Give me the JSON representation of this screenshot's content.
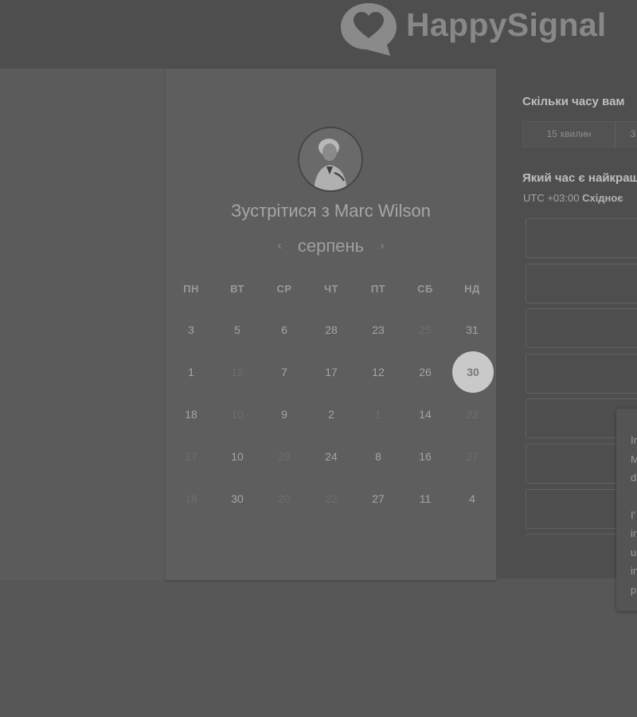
{
  "brand": {
    "name": "HappySignal"
  },
  "calendar": {
    "title": "Зустрітися з Marc Wilson",
    "month": "серпень",
    "prev_arrow": "‹",
    "next_arrow": "›",
    "weekdays": [
      "ПН",
      "ВТ",
      "СР",
      "ЧТ",
      "ПТ",
      "СБ",
      "НД"
    ],
    "weeks": [
      [
        {
          "d": "3",
          "off": false
        },
        {
          "d": "5",
          "off": false
        },
        {
          "d": "6",
          "off": false
        },
        {
          "d": "28",
          "off": false
        },
        {
          "d": "23",
          "off": false
        },
        {
          "d": "25",
          "off": true
        },
        {
          "d": "31",
          "off": false
        }
      ],
      [
        {
          "d": "1",
          "off": false
        },
        {
          "d": "12",
          "off": true
        },
        {
          "d": "7",
          "off": false
        },
        {
          "d": "17",
          "off": false
        },
        {
          "d": "12",
          "off": false
        },
        {
          "d": "26",
          "off": false
        },
        {
          "d": "30",
          "off": false,
          "selected": true
        }
      ],
      [
        {
          "d": "18",
          "off": false
        },
        {
          "d": "10",
          "off": true
        },
        {
          "d": "9",
          "off": false
        },
        {
          "d": "2",
          "off": false
        },
        {
          "d": "1",
          "off": true
        },
        {
          "d": "14",
          "off": false
        },
        {
          "d": "22",
          "off": true
        }
      ],
      [
        {
          "d": "27",
          "off": true
        },
        {
          "d": "10",
          "off": false
        },
        {
          "d": "29",
          "off": true
        },
        {
          "d": "24",
          "off": false
        },
        {
          "d": "8",
          "off": false
        },
        {
          "d": "16",
          "off": false
        },
        {
          "d": "27",
          "off": true
        }
      ],
      [
        {
          "d": "18",
          "off": true
        },
        {
          "d": "30",
          "off": false
        },
        {
          "d": "20",
          "off": true
        },
        {
          "d": "22",
          "off": true
        },
        {
          "d": "27",
          "off": false
        },
        {
          "d": "11",
          "off": false
        },
        {
          "d": "4",
          "off": false
        }
      ]
    ]
  },
  "booking": {
    "duration_question": "Скільки часу вам",
    "durations": [
      "15 хвилин",
      "3"
    ],
    "time_question": "Який час є найкращ",
    "timezone_offset": "UTC +03:00",
    "timezone_name": "Східноє"
  },
  "tooltip": {
    "lines": [
      "In",
      "M",
      "d",
      "I'",
      "in",
      "u",
      "in",
      "p"
    ]
  },
  "colors": {
    "overlay": "#575757",
    "selected_day": "#c9c9c9",
    "panel": "#4e4e4e"
  }
}
